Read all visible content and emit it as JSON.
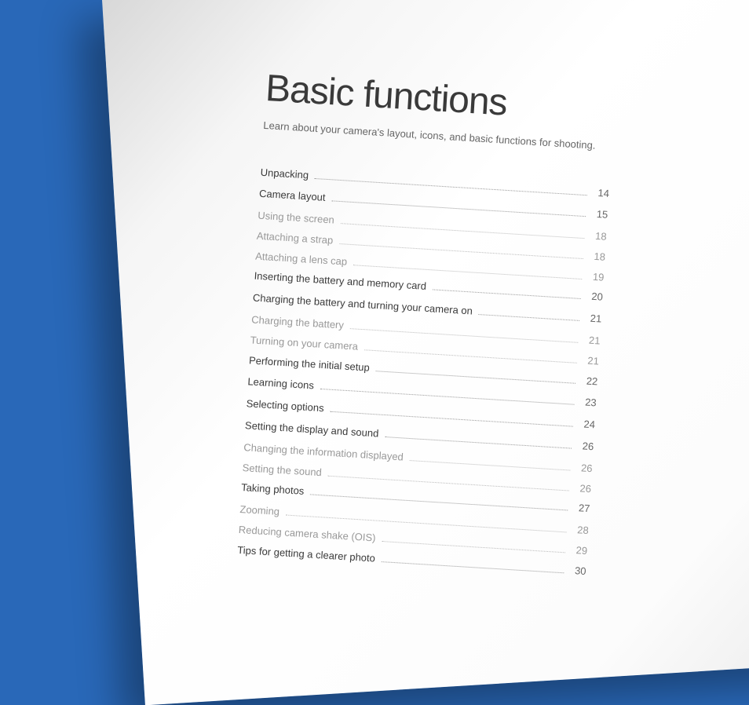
{
  "title": "Basic functions",
  "subtitle": "Learn about your camera's layout, icons, and basic functions for shooting.",
  "toc": [
    {
      "label": "Unpacking",
      "page": "14",
      "level": 0
    },
    {
      "label": "Camera layout",
      "page": "15",
      "level": 0
    },
    {
      "label": "Using the screen",
      "page": "18",
      "level": 1
    },
    {
      "label": "Attaching a strap",
      "page": "18",
      "level": 1
    },
    {
      "label": "Attaching a lens cap",
      "page": "19",
      "level": 1
    },
    {
      "label": "Inserting the battery and memory card",
      "page": "20",
      "level": 0
    },
    {
      "label": "Charging the battery and turning your camera on",
      "page": "21",
      "level": 0
    },
    {
      "label": "Charging the battery",
      "page": "21",
      "level": 1
    },
    {
      "label": "Turning on your camera",
      "page": "21",
      "level": 1
    },
    {
      "label": "Performing the initial setup",
      "page": "22",
      "level": 0
    },
    {
      "label": "Learning icons",
      "page": "23",
      "level": 0
    },
    {
      "label": "Selecting options",
      "page": "24",
      "level": 0
    },
    {
      "label": "Setting the display and sound",
      "page": "26",
      "level": 0
    },
    {
      "label": "Changing the information displayed",
      "page": "26",
      "level": 1
    },
    {
      "label": "Setting the sound",
      "page": "26",
      "level": 1
    },
    {
      "label": "Taking photos",
      "page": "27",
      "level": 0
    },
    {
      "label": "Zooming",
      "page": "28",
      "level": 1
    },
    {
      "label": "Reducing camera shake (OIS)",
      "page": "29",
      "level": 1
    },
    {
      "label": "Tips for getting a clearer photo",
      "page": "30",
      "level": 0
    }
  ]
}
